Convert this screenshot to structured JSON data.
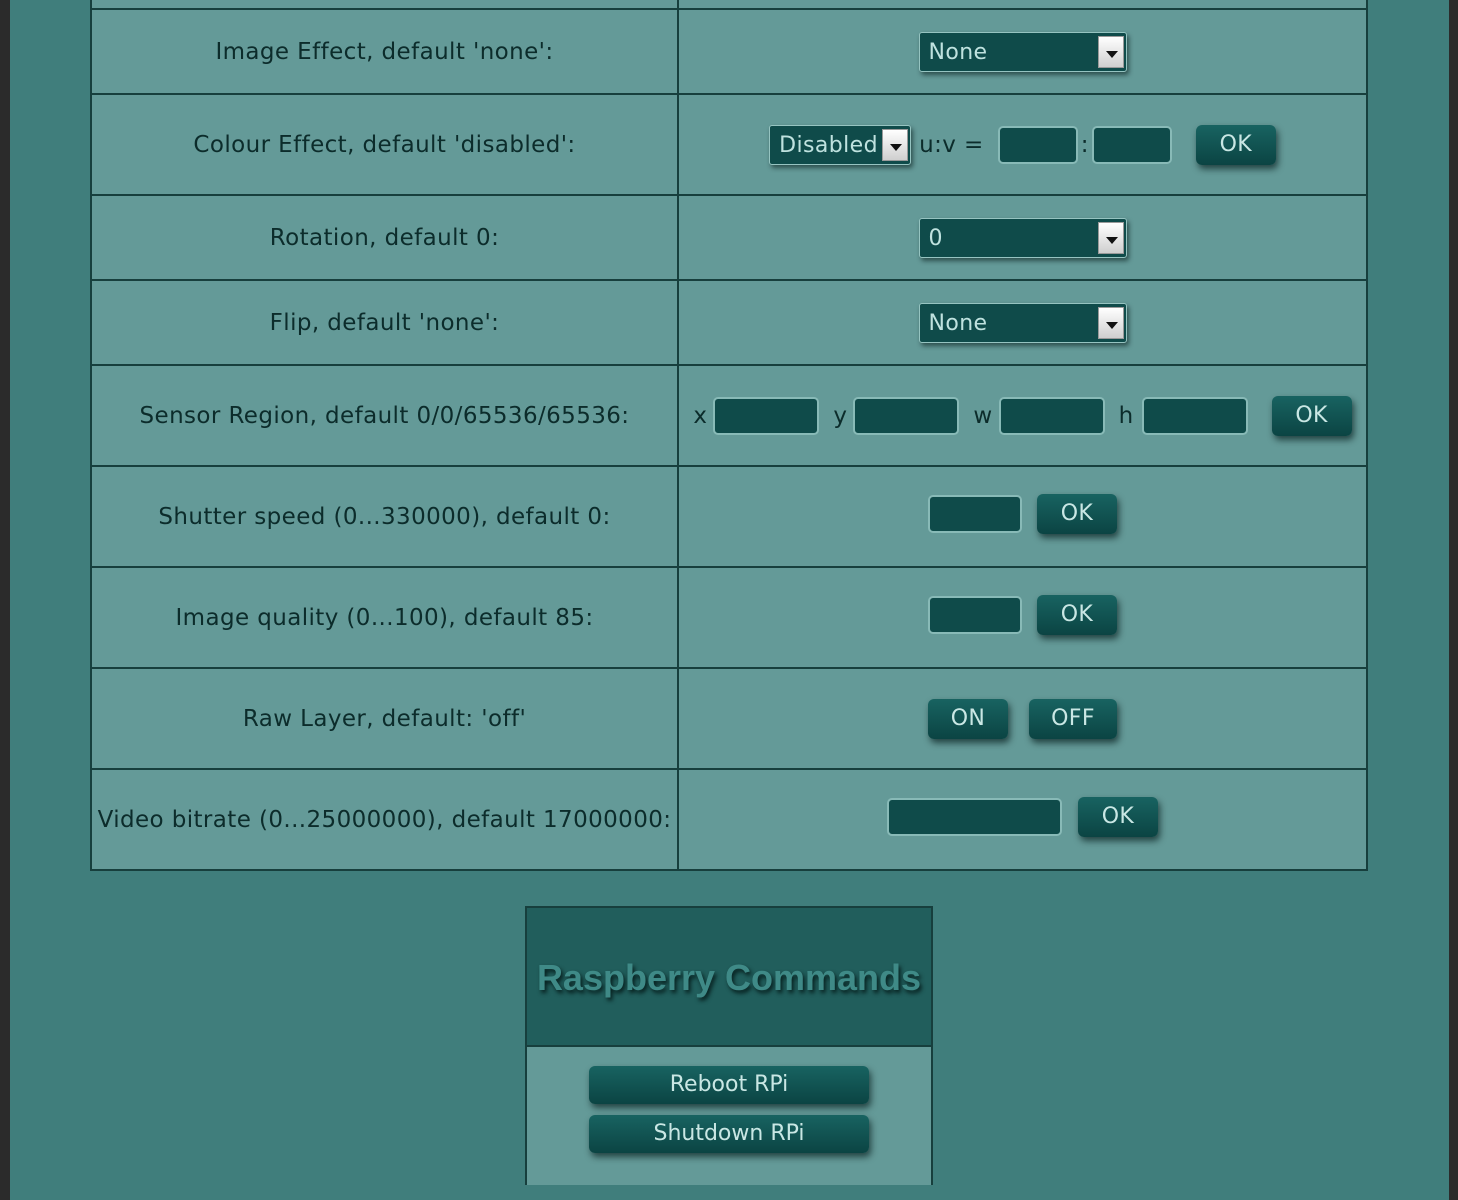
{
  "rows": {
    "image_effect": {
      "label": "Image Effect, default 'none':",
      "value": "None"
    },
    "colour_effect": {
      "label": "Colour Effect, default 'disabled':",
      "value": "Disabled",
      "uv_label": "u:v =",
      "sep": ":",
      "ok": "OK"
    },
    "rotation": {
      "label": "Rotation, default 0:",
      "value": "0"
    },
    "flip": {
      "label": "Flip, default 'none':",
      "value": "None"
    },
    "sensor_region": {
      "label": "Sensor Region, default 0/0/65536/65536:",
      "x": "x",
      "y": "y",
      "w": "w",
      "h": "h",
      "ok": "OK"
    },
    "shutter": {
      "label": "Shutter speed (0...330000), default 0:",
      "ok": "OK"
    },
    "quality": {
      "label": "Image quality (0...100), default 85:",
      "ok": "OK"
    },
    "raw_layer": {
      "label": "Raw Layer, default: 'off'",
      "on": "ON",
      "off": "OFF"
    },
    "bitrate": {
      "label": "Video bitrate (0...25000000), default 17000000:",
      "ok": "OK"
    }
  },
  "commands": {
    "title": "Raspberry Commands",
    "reboot": "Reboot RPi",
    "shutdown": "Shutdown RPi"
  },
  "colors": {
    "page_bg": "#407e7c",
    "cell_bg": "#649a98",
    "control_bg": "#0f4b4a",
    "border": "#173f3d"
  }
}
